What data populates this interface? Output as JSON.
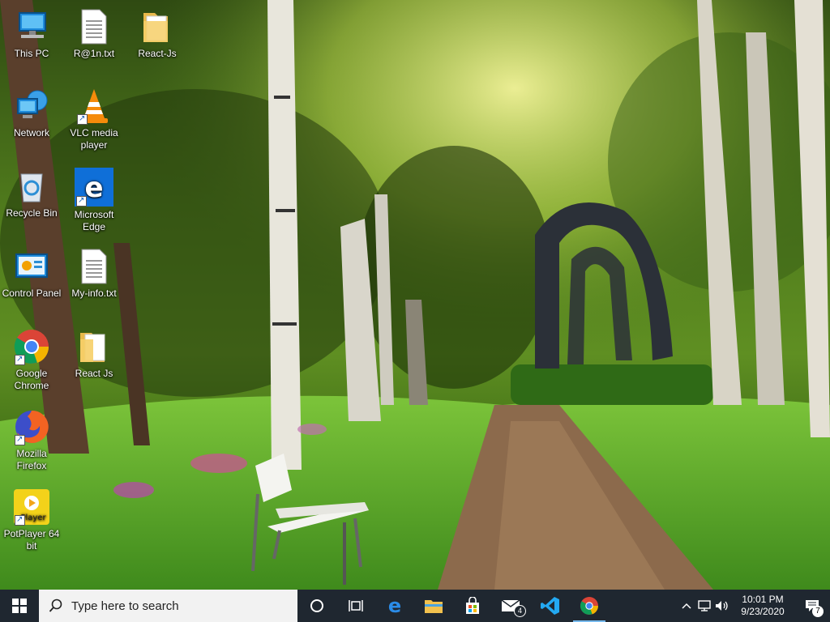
{
  "desktop": {
    "icons": [
      {
        "label": "This PC",
        "icon": "this-pc-icon"
      },
      {
        "label": "R@1n.txt",
        "icon": "text-file-icon"
      },
      {
        "label": "React-Js",
        "icon": "folder-icon"
      },
      {
        "label": "Network",
        "icon": "network-icon"
      },
      {
        "label": "VLC media player",
        "icon": "vlc-icon"
      },
      {
        "label": "Recycle Bin",
        "icon": "recycle-bin-icon"
      },
      {
        "label": "Microsoft Edge",
        "icon": "edge-icon"
      },
      {
        "label": "Control Panel",
        "icon": "control-panel-icon"
      },
      {
        "label": "My-info.txt",
        "icon": "text-file-icon"
      },
      {
        "label": "Google Chrome",
        "icon": "chrome-icon"
      },
      {
        "label": "React Js",
        "icon": "folder-icon"
      },
      {
        "label": "Mozilla Firefox",
        "icon": "firefox-icon"
      },
      {
        "label": "PotPlayer 64 bit",
        "icon": "potplayer-icon"
      }
    ]
  },
  "taskbar": {
    "search_placeholder": "Type here to search",
    "pinned": [
      "cortana-icon",
      "task-view-icon",
      "edge-icon",
      "file-explorer-icon",
      "store-icon",
      "mail-icon",
      "vscode-icon",
      "chrome-icon"
    ],
    "mail_badge": "4",
    "clock": {
      "time": "10:01 PM",
      "date": "9/23/2020"
    },
    "notification_count": "7"
  },
  "colors": {
    "taskbar_bg": "#1f2730",
    "accent": "#76b9ed"
  }
}
